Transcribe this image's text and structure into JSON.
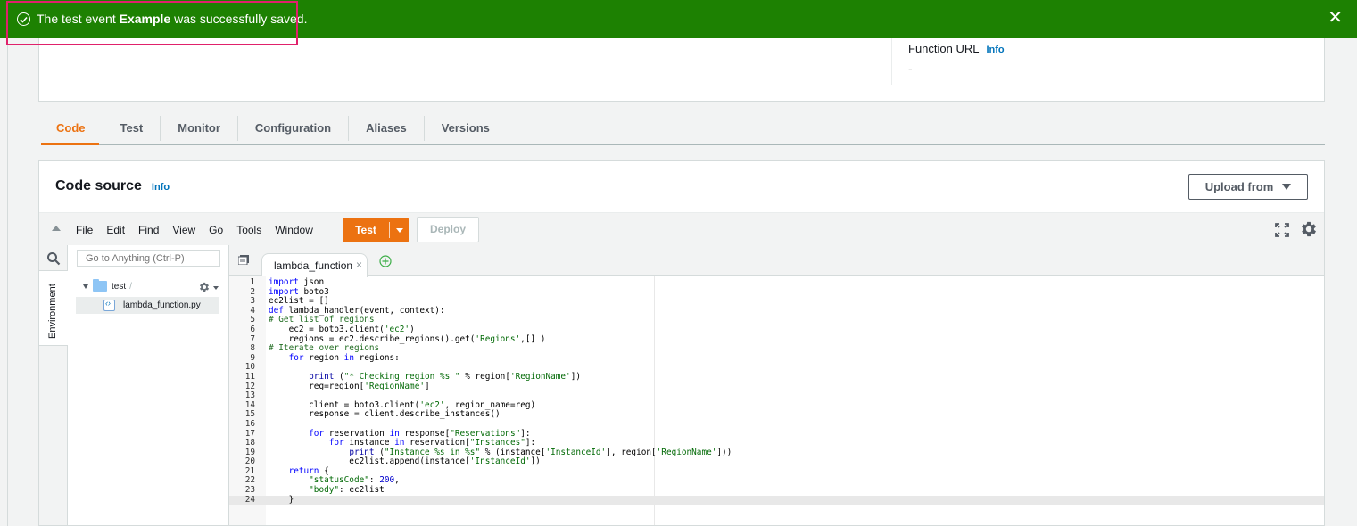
{
  "flash": {
    "prefix": "The test event ",
    "event_name": "Example",
    "suffix": " was successfully saved.",
    "close": "✕"
  },
  "overview": {
    "function_url_label": "Function URL",
    "info": "Info",
    "function_url_value": "-"
  },
  "tabs": [
    {
      "label": "Code",
      "active": true
    },
    {
      "label": "Test"
    },
    {
      "label": "Monitor"
    },
    {
      "label": "Configuration"
    },
    {
      "label": "Aliases"
    },
    {
      "label": "Versions"
    }
  ],
  "code_source": {
    "title": "Code source",
    "info": "Info",
    "upload_label": "Upload from"
  },
  "ide": {
    "menu": [
      "File",
      "Edit",
      "Find",
      "View",
      "Go",
      "Tools",
      "Window"
    ],
    "test_label": "Test",
    "deploy_label": "Deploy",
    "goto_placeholder": "Go to Anything (Ctrl-P)",
    "environment_label": "Environment",
    "folder_name": "test",
    "folder_suffix": "/",
    "file_name": "lambda_function.py",
    "open_tab": "lambda_function",
    "tab_close": "×"
  },
  "code_lines": [
    "import json",
    "import boto3",
    "ec2list = []",
    "def lambda_handler(event, context):",
    "# Get list of regions",
    "    ec2 = boto3.client('ec2')",
    "    regions = ec2.describe_regions().get('Regions',[] )",
    "# Iterate over regions",
    "    for region in regions:",
    "",
    "        print (\"* Checking region %s \" % region['RegionName'])",
    "        reg=region['RegionName']",
    "",
    "        client = boto3.client('ec2', region_name=reg)",
    "        response = client.describe_instances()",
    "",
    "        for reservation in response[\"Reservations\"]:",
    "            for instance in reservation[\"Instances\"]:",
    "                print (\"Instance %s in %s\" % (instance['InstanceId'], region['RegionName']))",
    "                ec2list.append(instance['InstanceId'])",
    "    return {",
    "        \"statusCode\": 200,",
    "        \"body\": ec2list",
    "    }"
  ],
  "colors": {
    "success": "#1d8102",
    "accent": "#ec7211",
    "link": "#0073bb"
  }
}
